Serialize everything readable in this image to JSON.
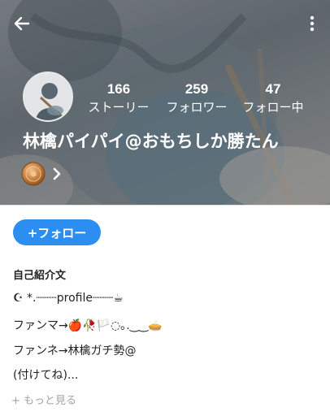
{
  "header": {
    "back_icon": "arrow-left-icon",
    "more_icon": "more-vertical-icon",
    "stats": [
      {
        "count": "166",
        "label": "ストーリー"
      },
      {
        "count": "259",
        "label": "フォロワー"
      },
      {
        "count": "47",
        "label": "フォロー中"
      }
    ],
    "username": "林檎パイパイ@おもちしか勝たん",
    "badge_icon": "bronze-medal-icon",
    "badge_chevron_icon": "chevron-right-icon"
  },
  "profile": {
    "follow_label": "+フォロー",
    "bio_title": "自己紹介文",
    "bio_lines": [
      "☪︎ *.┈┈┈profile┈┈┈☕",
      "ファンマ→🍎🥀🏳️◌｡.‿‿🥧",
      "ファンネ→林檎ガチ勢@",
      "(付けてね)..."
    ],
    "see_more": "+ もっと見る"
  },
  "colors": {
    "accent": "#2b8ef0",
    "header_overlay": "#6e767c",
    "muted_text": "#a3a3a3"
  }
}
